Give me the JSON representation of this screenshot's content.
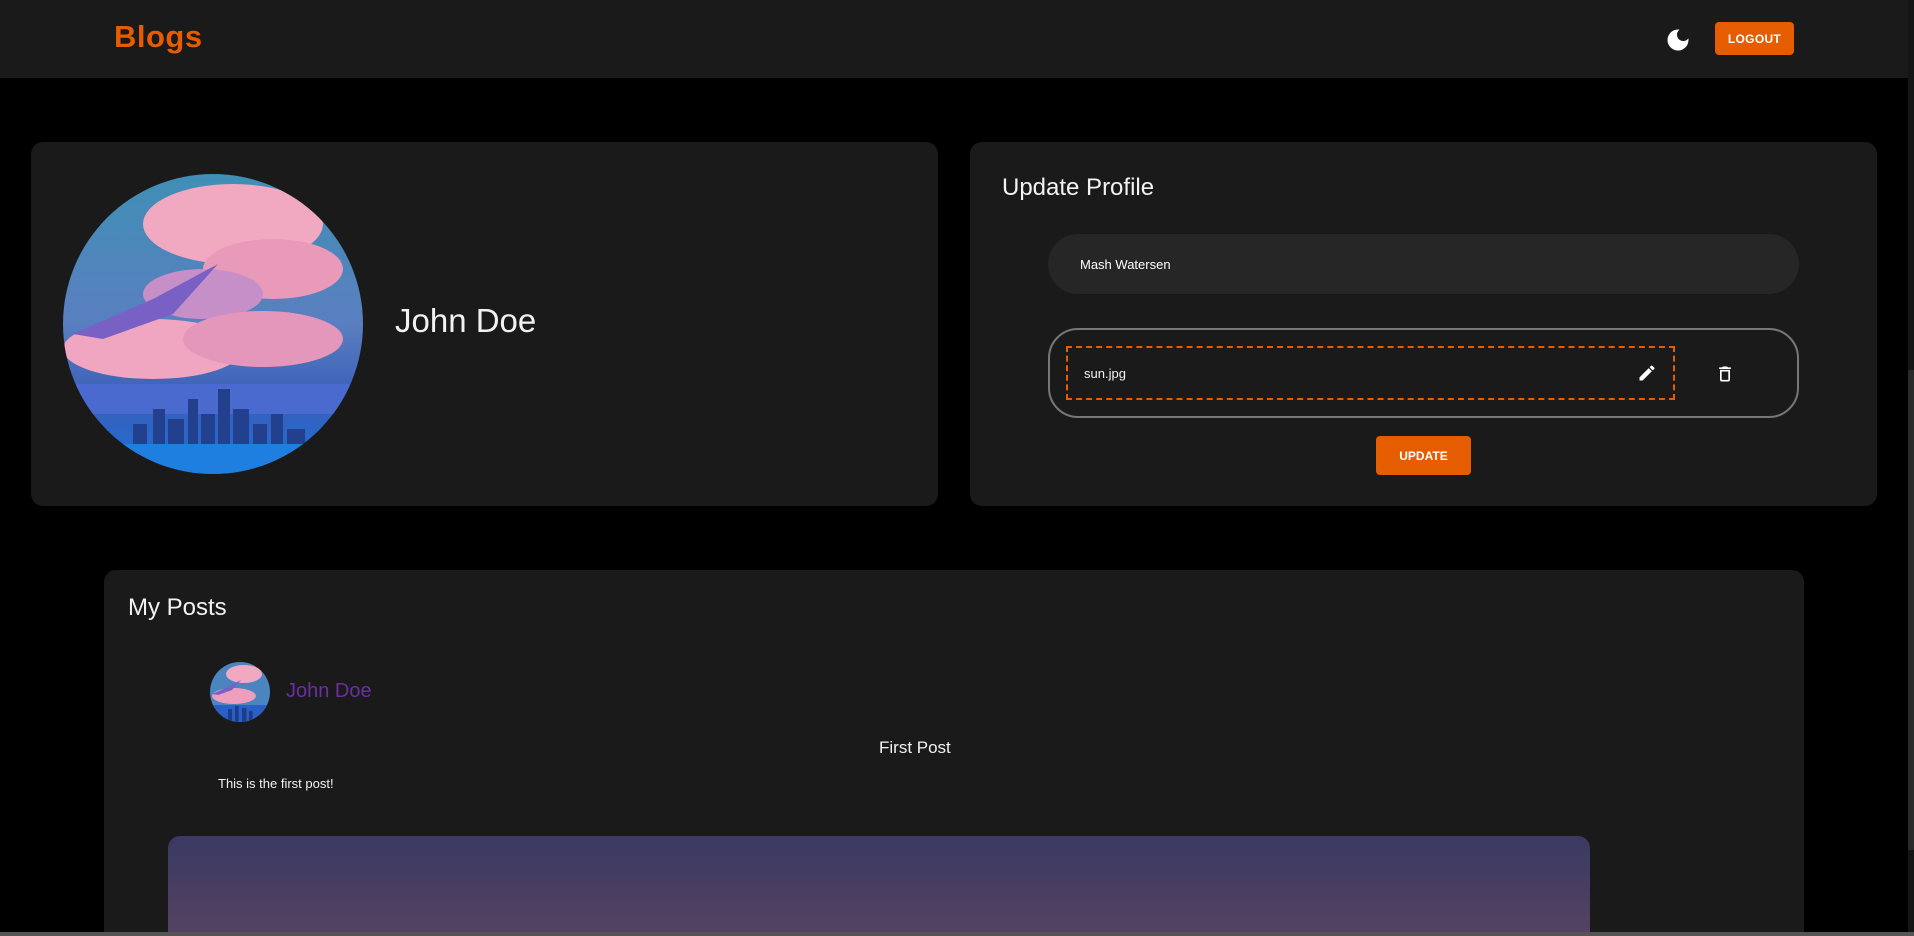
{
  "header": {
    "brand": "Blogs",
    "theme_icon": "moon-icon",
    "logout_label": "LOGOUT"
  },
  "colors": {
    "accent": "#e65c00",
    "background": "#000000",
    "surface": "#1a1a1a",
    "author_link": "#6a2fa0"
  },
  "profile": {
    "name": "John Doe"
  },
  "update_profile": {
    "title": "Update Profile",
    "name_value": "Mash Watersen",
    "file_name": "sun.jpg",
    "edit_icon": "pencil-icon",
    "delete_icon": "trash-icon",
    "submit_label": "UPDATE"
  },
  "posts": {
    "title": "My Posts",
    "items": [
      {
        "author": "John Doe",
        "title": "First Post",
        "body": "This is the first post!"
      }
    ]
  }
}
